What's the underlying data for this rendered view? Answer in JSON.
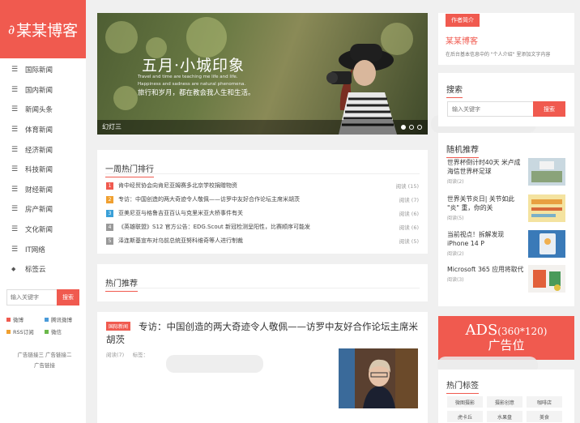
{
  "brand": {
    "logo_text": "某某博客"
  },
  "nav": [
    {
      "icon": "list-icon",
      "label": "国际新闻"
    },
    {
      "icon": "list-icon",
      "label": "国内新闻"
    },
    {
      "icon": "list-icon",
      "label": "新闻头条"
    },
    {
      "icon": "list-icon",
      "label": "体育新闻"
    },
    {
      "icon": "list-icon",
      "label": "经济新闻"
    },
    {
      "icon": "list-icon",
      "label": "科技新闻"
    },
    {
      "icon": "list-icon",
      "label": "财经新闻"
    },
    {
      "icon": "list-icon",
      "label": "房产新闻"
    },
    {
      "icon": "list-icon",
      "label": "文化新闻"
    },
    {
      "icon": "list-icon",
      "label": "IT网络"
    },
    {
      "icon": "tag-icon",
      "label": "标签云"
    }
  ],
  "left_search": {
    "placeholder": "输入关键字",
    "button": "搜索"
  },
  "social": [
    {
      "label": "微博",
      "color": "#f05a4f"
    },
    {
      "label": "腾讯微博",
      "color": "#4a9bd9"
    },
    {
      "label": "RSS订阅",
      "color": "#f0a030"
    },
    {
      "label": "微信",
      "color": "#6bb84a"
    }
  ],
  "ad_links": {
    "line1": "广告链接三   广告链接二",
    "line2": "广告链接"
  },
  "slider": {
    "title": "五月·小城印象",
    "en_line1": "Travel and time are teaching me life and life.",
    "en_line2": "Happiness and sadness are natural phenomena.",
    "cn_line": "旅行和岁月，都在教会我人生和生活。",
    "caption": "幻灯三"
  },
  "hot": {
    "title": "一周热门排行",
    "items": [
      {
        "num": "1",
        "color": "#f05a4f",
        "title": "肯中经贸协会向肯尼亚姆赛多北京学校捐赠物资",
        "views": "阅读 (15)"
      },
      {
        "num": "2",
        "color": "#f0a030",
        "title": "专访：中国创造的两大奇迹令人敬佩——访罗中友好合作论坛主席米胡茨",
        "views": "阅读 (7)"
      },
      {
        "num": "3",
        "color": "#3aa0d8",
        "title": "亚美尼亚与格鲁吉亚百认与克里米亚大桥事件有关",
        "views": "阅读 (6)"
      },
      {
        "num": "4",
        "color": "#999999",
        "title": "《英雄联盟》S12 官方公告：EDG.Scout 新冠检测呈阳性，比赛顺序可能发",
        "views": "阅读 (6)"
      },
      {
        "num": "5",
        "color": "#999999",
        "title": "泽连斯基宣布对乌前总统亚努科维奇等人进行制裁",
        "views": "阅读 (5)"
      }
    ]
  },
  "recommend": {
    "title": "热门推荐"
  },
  "article": {
    "tag": "国际新闻",
    "title": "专访：中国创造的两大奇迹令人敬佩——访罗中友好合作论坛主席米胡茨",
    "views": "阅读(7)",
    "tags_label": "标签："
  },
  "author": {
    "badge": "作者简介",
    "name": "某某博客",
    "desc": "在后台基本信息中的 \"个人介绍\" 里添加文字内容"
  },
  "right_search": {
    "title": "搜索",
    "placeholder": "输入关键字",
    "button": "搜索"
  },
  "random": {
    "title": "随机推荐",
    "items": [
      {
        "title": "世界杯倒计时40天 米卢成海信世界杯足球",
        "views": "阅读(2)"
      },
      {
        "title": "世界关节炎日| 关节如此 \"炎\" 重，你的关",
        "views": "阅读(5)"
      },
      {
        "title": "当前视点！拆解发现 iPhone 14 P",
        "views": "阅读(2)"
      },
      {
        "title": "Microsoft 365 应用将取代",
        "views": "阅读(3)"
      }
    ]
  },
  "ads": {
    "line1": "ADS",
    "size": "(360*120)",
    "line2": "广告位"
  },
  "hot_tags": {
    "title": "热门标签",
    "items": [
      "微图摄影",
      "摄影创意",
      "咖啡店",
      "虎卡丘",
      "水果盘",
      "美食"
    ]
  }
}
